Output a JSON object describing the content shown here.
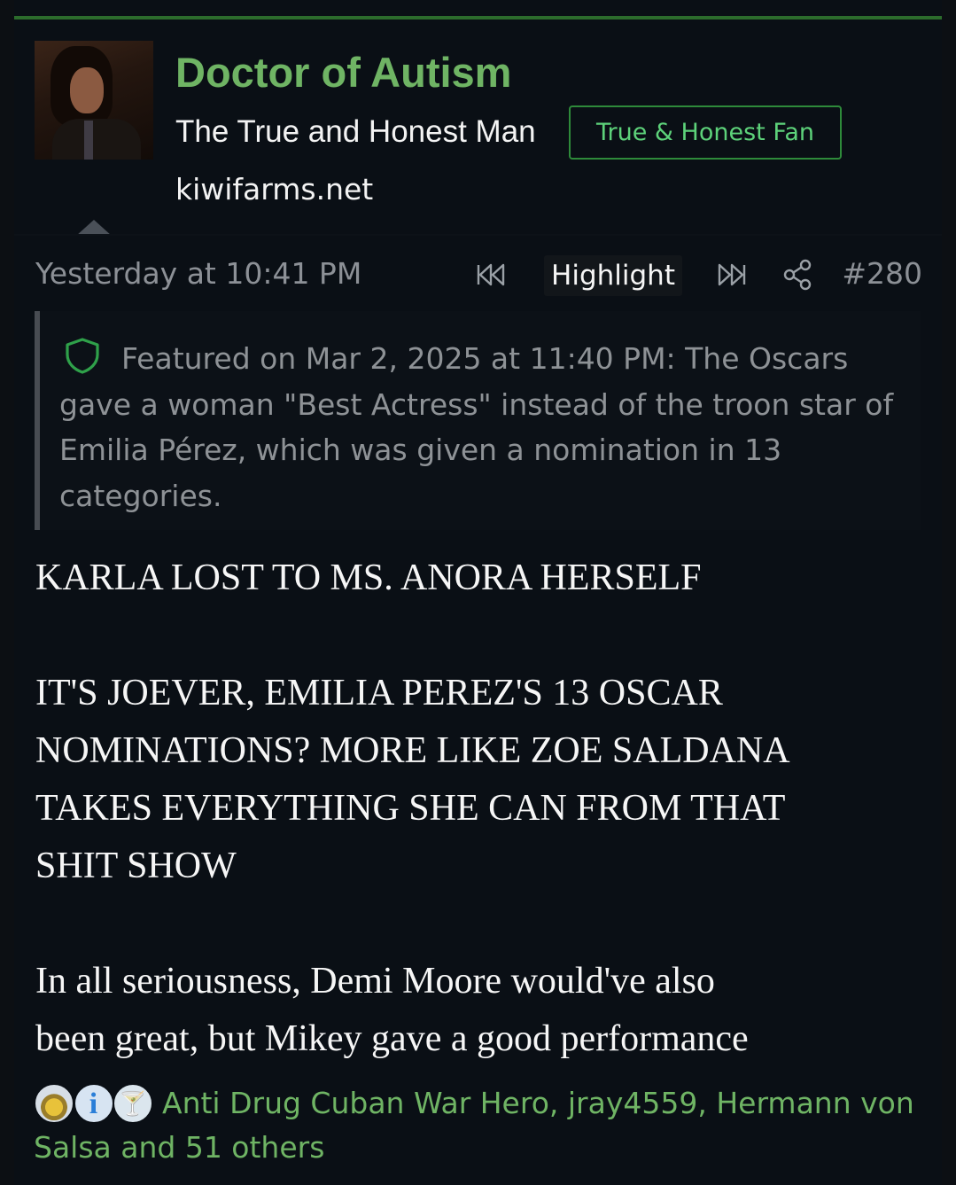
{
  "post": {
    "author": {
      "name": "Doctor of Autism",
      "title": "The True and Honest Man",
      "banner": "True & Honest Fan",
      "site": "kiwifarms.net"
    },
    "meta": {
      "timestamp": "Yesterday at 10:41 PM",
      "highlight_label": "Highlight",
      "post_number": "#280"
    },
    "featured_note": "Featured on Mar 2, 2025 at 11:40 PM: The Oscars gave a woman \"Best Actress\" instead of the troon star of Emilia Pérez, which was given a nomination in 13 categories.",
    "body": {
      "paragraph_1": "KARLA LOST TO MS. ANORA HERSELF",
      "paragraph_2": "IT'S JOEVER, EMILIA PEREZ'S 13 OSCAR\nNOMINATIONS? MORE LIKE ZOE SALDANA\nTAKES EVERYTHING SHE CAN FROM THAT\nSHIT SHOW",
      "paragraph_3": "In all seriousness, Demi Moore would've also\nbeen great, but Mikey gave a good performance"
    },
    "reactions": {
      "icons": [
        "medal-icon",
        "informative-icon",
        "cocktail-icon"
      ],
      "text": "Anti Drug Cuban War Hero, jray4559, Hermann von Salsa and 51 others"
    }
  },
  "colors": {
    "accent_green": "#6fb464",
    "banner_green": "#5dd27a",
    "top_rule": "#2c6c2c",
    "background": "#0a0f15"
  },
  "icons": {
    "rewind": "rewind-icon",
    "fast_forward": "fast-forward-icon",
    "share": "share-icon",
    "shield": "shield-icon",
    "collapse": "caret-up-icon"
  }
}
